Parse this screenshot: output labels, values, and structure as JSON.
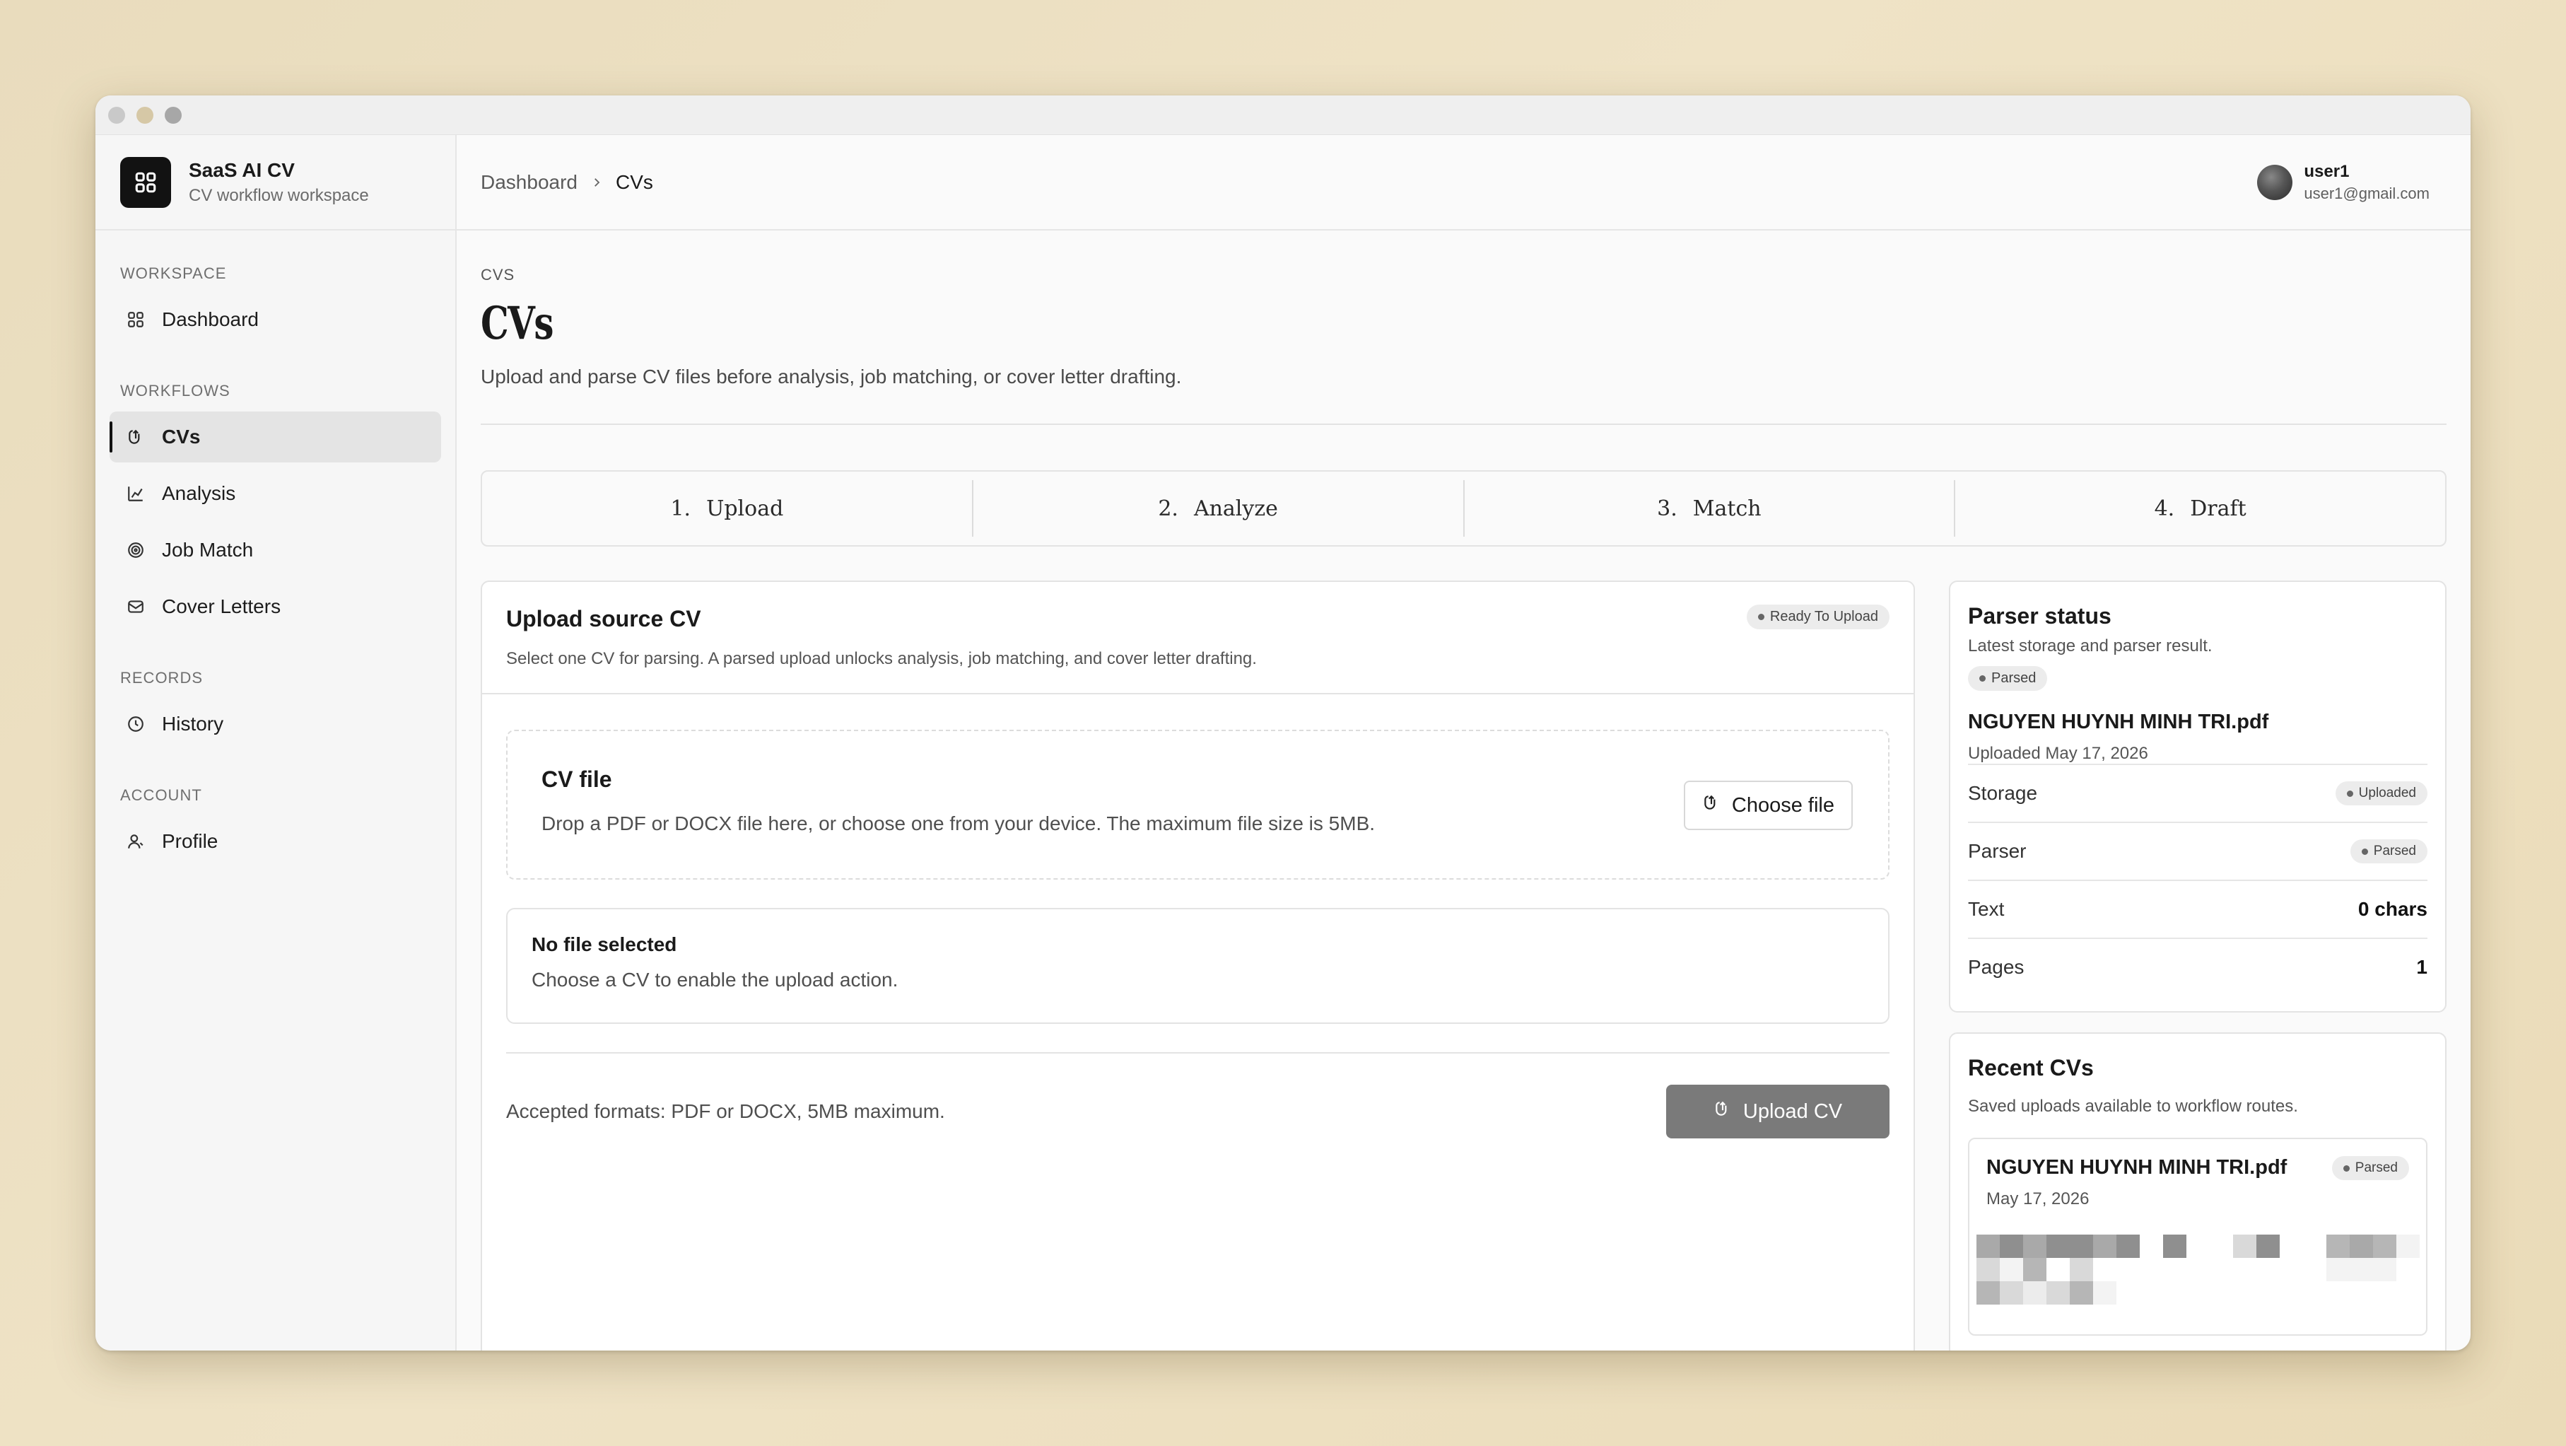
{
  "app": {
    "name": "SaaS AI CV",
    "subtitle": "CV workflow workspace"
  },
  "sidebar": {
    "sections": [
      {
        "title": "WORKSPACE",
        "items": [
          {
            "label": "Dashboard",
            "icon": "grid-icon"
          }
        ]
      },
      {
        "title": "WORKFLOWS",
        "items": [
          {
            "label": "CVs",
            "icon": "file-upload-icon",
            "active": true
          },
          {
            "label": "Analysis",
            "icon": "chart-icon"
          },
          {
            "label": "Job Match",
            "icon": "target-icon"
          },
          {
            "label": "Cover Letters",
            "icon": "mail-icon"
          }
        ]
      },
      {
        "title": "RECORDS",
        "items": [
          {
            "label": "History",
            "icon": "clock-icon"
          }
        ]
      },
      {
        "title": "ACCOUNT",
        "items": [
          {
            "label": "Profile",
            "icon": "user-icon"
          }
        ]
      }
    ]
  },
  "breadcrumb": {
    "root": "Dashboard",
    "current": "CVs"
  },
  "user": {
    "name": "user1",
    "email": "user1@gmail.com"
  },
  "page": {
    "eyebrow": "CVS",
    "title": "CVs",
    "description": "Upload and parse CV files before analysis, job matching, or cover letter drafting."
  },
  "steps": [
    {
      "num": "1.",
      "label": "Upload"
    },
    {
      "num": "2.",
      "label": "Analyze"
    },
    {
      "num": "3.",
      "label": "Match"
    },
    {
      "num": "4.",
      "label": "Draft"
    }
  ],
  "upload": {
    "title": "Upload source CV",
    "badge": "Ready To Upload",
    "description": "Select one CV for parsing. A parsed upload unlocks analysis, job matching, and cover letter drafting.",
    "dropzone_title": "CV file",
    "dropzone_desc": "Drop a PDF or DOCX file here, or choose one from your device. The maximum file size is 5MB.",
    "choose_label": "Choose file",
    "file_title": "No file selected",
    "file_desc": "Choose a CV to enable the upload action.",
    "footer_text": "Accepted formats: PDF or DOCX, 5MB maximum.",
    "upload_label": "Upload CV"
  },
  "parser": {
    "title": "Parser status",
    "subtitle": "Latest storage and parser result.",
    "badge": "Parsed",
    "file": "NGUYEN HUYNH MINH TRI.pdf",
    "uploaded": "Uploaded May 17, 2026",
    "rows": [
      {
        "key": "Storage",
        "badge": "Uploaded"
      },
      {
        "key": "Parser",
        "badge": "Parsed"
      },
      {
        "key": "Text",
        "value": "0 chars"
      },
      {
        "key": "Pages",
        "value": "1"
      }
    ]
  },
  "recent": {
    "title": "Recent CVs",
    "subtitle": "Saved uploads available to workflow routes.",
    "items": [
      {
        "name": "NGUYEN HUYNH MINH TRI.pdf",
        "date": "May 17, 2026",
        "badge": "Parsed"
      }
    ]
  }
}
